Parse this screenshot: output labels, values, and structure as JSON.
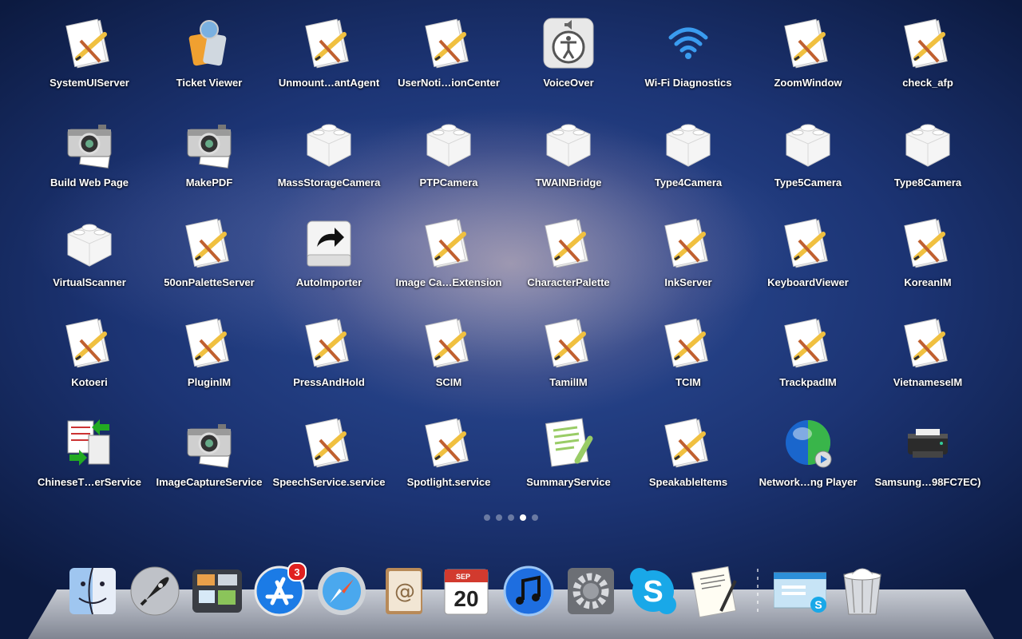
{
  "launchpad": {
    "apps": [
      {
        "label": "SystemUIServer",
        "icon": "app-pen-icon"
      },
      {
        "label": "Ticket Viewer",
        "icon": "ticket-viewer-icon"
      },
      {
        "label": "Unmount…antAgent",
        "icon": "app-pen-icon"
      },
      {
        "label": "UserNoti…ionCenter",
        "icon": "app-pen-icon"
      },
      {
        "label": "VoiceOver",
        "icon": "voiceover-icon"
      },
      {
        "label": "Wi-Fi Diagnostics",
        "icon": "wifi-icon"
      },
      {
        "label": "ZoomWindow",
        "icon": "app-pen-icon"
      },
      {
        "label": "check_afp",
        "icon": "app-pen-icon"
      },
      {
        "label": "Build Web Page",
        "icon": "camera-icon"
      },
      {
        "label": "MakePDF",
        "icon": "camera-icon"
      },
      {
        "label": "MassStorageCamera",
        "icon": "lego-block-icon"
      },
      {
        "label": "PTPCamera",
        "icon": "lego-block-icon"
      },
      {
        "label": "TWAINBridge",
        "icon": "lego-block-icon"
      },
      {
        "label": "Type4Camera",
        "icon": "lego-block-icon"
      },
      {
        "label": "Type5Camera",
        "icon": "lego-block-icon"
      },
      {
        "label": "Type8Camera",
        "icon": "lego-block-icon"
      },
      {
        "label": "VirtualScanner",
        "icon": "lego-block-icon"
      },
      {
        "label": "50onPaletteServer",
        "icon": "app-pen-icon"
      },
      {
        "label": "AutoImporter",
        "icon": "auto-importer-icon"
      },
      {
        "label": "Image Ca…Extension",
        "icon": "app-pen-icon"
      },
      {
        "label": "CharacterPalette",
        "icon": "app-pen-icon"
      },
      {
        "label": "InkServer",
        "icon": "app-pen-icon"
      },
      {
        "label": "KeyboardViewer",
        "icon": "app-pen-icon"
      },
      {
        "label": "KoreanIM",
        "icon": "app-pen-icon"
      },
      {
        "label": "Kotoeri",
        "icon": "app-pen-icon"
      },
      {
        "label": "PluginIM",
        "icon": "app-pen-icon"
      },
      {
        "label": "PressAndHold",
        "icon": "app-pen-icon"
      },
      {
        "label": "SCIM",
        "icon": "app-pen-icon"
      },
      {
        "label": "TamilIM",
        "icon": "app-pen-icon"
      },
      {
        "label": "TCIM",
        "icon": "app-pen-icon"
      },
      {
        "label": "TrackpadIM",
        "icon": "app-pen-icon"
      },
      {
        "label": "VietnameseIM",
        "icon": "app-pen-icon"
      },
      {
        "label": "ChineseT…erService",
        "icon": "chinese-converter-icon"
      },
      {
        "label": "ImageCaptureService",
        "icon": "camera-icon"
      },
      {
        "label": "SpeechService.service",
        "icon": "app-pen-icon"
      },
      {
        "label": "Spotlight.service",
        "icon": "app-pen-icon"
      },
      {
        "label": "SummaryService",
        "icon": "summary-icon"
      },
      {
        "label": "SpeakableItems",
        "icon": "app-pen-icon"
      },
      {
        "label": "Network…ng Player",
        "icon": "network-player-icon"
      },
      {
        "label": "Samsung…98FC7EC)",
        "icon": "printer-icon"
      }
    ],
    "page_count": 5,
    "active_page": 4
  },
  "dock": {
    "items": [
      {
        "name": "finder",
        "icon": "finder-icon"
      },
      {
        "name": "launchpad",
        "icon": "rocket-icon"
      },
      {
        "name": "mission-control",
        "icon": "mission-control-icon"
      },
      {
        "name": "app-store",
        "icon": "app-store-icon",
        "badge": "3"
      },
      {
        "name": "safari",
        "icon": "compass-icon"
      },
      {
        "name": "address-book",
        "icon": "address-book-icon"
      },
      {
        "name": "ical",
        "icon": "calendar-icon",
        "month": "SEP",
        "day": "20"
      },
      {
        "name": "itunes",
        "icon": "music-note-icon"
      },
      {
        "name": "system-preferences",
        "icon": "gear-icon"
      },
      {
        "name": "skype",
        "icon": "skype-icon"
      },
      {
        "name": "textedit",
        "icon": "textedit-icon"
      },
      {
        "name": "skype-window",
        "icon": "skype-window-icon"
      },
      {
        "name": "trash",
        "icon": "trash-icon"
      }
    ]
  },
  "colors": {
    "badge": "#e02020",
    "wifi": "#3a9cf0",
    "skype": "#19a8e8"
  }
}
